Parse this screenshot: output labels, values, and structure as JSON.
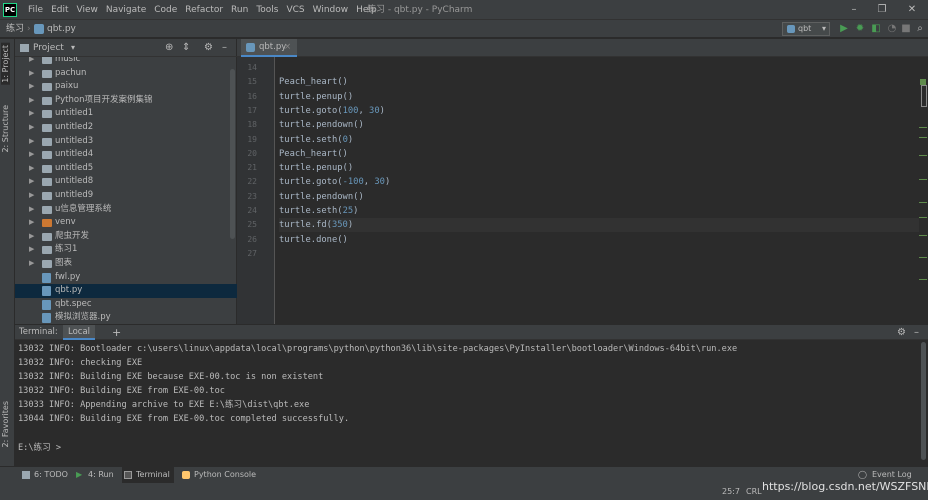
{
  "titlebar": {
    "menu": [
      "File",
      "Edit",
      "View",
      "Navigate",
      "Code",
      "Refactor",
      "Run",
      "Tools",
      "VCS",
      "Window",
      "Help"
    ],
    "window_title": "练习 - qbt.py - PyCharm"
  },
  "navbar": {
    "crumbs": [
      "练习",
      "qbt.py"
    ],
    "run_config": "qbt"
  },
  "left_strip": {
    "project_tab": "1: Project",
    "structure_tab": "2: Structure",
    "favorites_tab": "2: Favorites"
  },
  "project": {
    "title": "Project",
    "items": [
      {
        "label": "music",
        "type": "folder"
      },
      {
        "label": "pachun",
        "type": "folder"
      },
      {
        "label": "paixu",
        "type": "folder"
      },
      {
        "label": "Python项目开发案例集锦",
        "type": "folder"
      },
      {
        "label": "untitled1",
        "type": "folder"
      },
      {
        "label": "untitled2",
        "type": "folder"
      },
      {
        "label": "untitled3",
        "type": "folder"
      },
      {
        "label": "untitled4",
        "type": "folder"
      },
      {
        "label": "untitled5",
        "type": "folder"
      },
      {
        "label": "untitled8",
        "type": "folder"
      },
      {
        "label": "untitled9",
        "type": "folder"
      },
      {
        "label": "u信息管理系统",
        "type": "folder"
      },
      {
        "label": "venv",
        "type": "folder"
      },
      {
        "label": "爬虫开发",
        "type": "folder"
      },
      {
        "label": "练习1",
        "type": "folder"
      },
      {
        "label": "图表",
        "type": "folder"
      },
      {
        "label": "fwl.py",
        "type": "file"
      },
      {
        "label": "qbt.py",
        "type": "file"
      },
      {
        "label": "qbt.spec",
        "type": "file"
      },
      {
        "label": "模拟浏览器.py",
        "type": "file"
      }
    ]
  },
  "editor": {
    "tab": "qbt.py",
    "line_numbers": [
      "14",
      "15",
      "16",
      "17",
      "18",
      "19",
      "20",
      "21",
      "22",
      "23",
      "24",
      "25",
      "26",
      "27"
    ],
    "lines": [
      "",
      "Peach_heart()",
      "turtle.penup()",
      "turtle.goto(100, 30)",
      "turtle.pendown()",
      "turtle.seth(0)",
      "Peach_heart()",
      "turtle.penup()",
      "turtle.goto(-100, 30)",
      "turtle.pendown()",
      "turtle.seth(25)",
      "turtle.fd(350)",
      "turtle.done()",
      ""
    ]
  },
  "terminal": {
    "label": "Terminal:",
    "tab": "Local",
    "add": "+",
    "lines": [
      "13032 INFO: Bootloader c:\\users\\linux\\appdata\\local\\programs\\python\\python36\\lib\\site-packages\\PyInstaller\\bootloader\\Windows-64bit\\run.exe",
      "13032 INFO: checking EXE",
      "13032 INFO: Building EXE because EXE-00.toc is non existent",
      "13032 INFO: Building EXE from EXE-00.toc",
      "13033 INFO: Appending archive to EXE E:\\练习\\dist\\qbt.exe",
      "13044 INFO: Building EXE from EXE-00.toc completed successfully.",
      "",
      "E:\\练习 >"
    ]
  },
  "statusbar": {
    "tabs": [
      "6: TODO",
      "4: Run",
      "Terminal",
      "Python Console"
    ],
    "event_log": "Event Log",
    "position": "25:7",
    "encoding": "CRL",
    "watermark": "https://blog.csdn.net/WSZFSNFK"
  }
}
